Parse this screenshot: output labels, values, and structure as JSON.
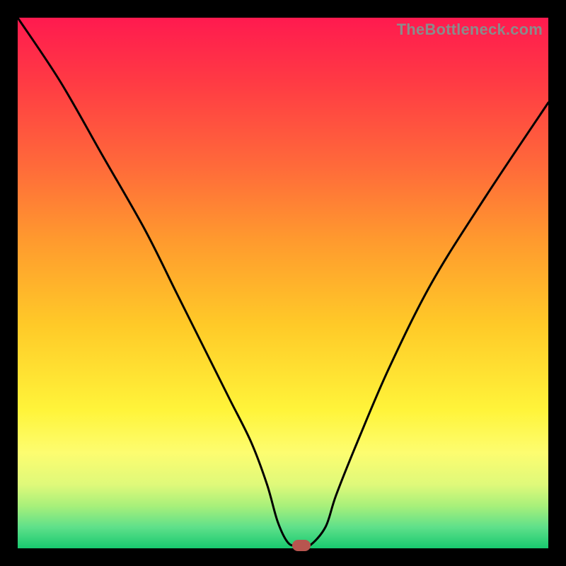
{
  "watermark": "TheBottleneck.com",
  "chart_data": {
    "type": "line",
    "title": "",
    "xlabel": "",
    "ylabel": "",
    "xlim": [
      0,
      100
    ],
    "ylim": [
      0,
      100
    ],
    "grid": false,
    "series": [
      {
        "name": "curve",
        "x": [
          0,
          8,
          16,
          24,
          30,
          36,
          40,
          44,
          47,
          49,
          51,
          53,
          55,
          58,
          60,
          64,
          70,
          78,
          88,
          100
        ],
        "values": [
          100,
          88,
          74,
          60,
          48,
          36,
          28,
          20,
          12,
          5,
          1,
          0.5,
          0.5,
          4,
          10,
          20,
          34,
          50,
          66,
          84
        ]
      }
    ],
    "marker": {
      "x": 53.5,
      "y": 0.5,
      "color": "#b8554f"
    },
    "gradient_stops": [
      {
        "pos": 0,
        "color": "#ff1a4f"
      },
      {
        "pos": 12,
        "color": "#ff3a44"
      },
      {
        "pos": 28,
        "color": "#ff6a3a"
      },
      {
        "pos": 42,
        "color": "#ff9a2e"
      },
      {
        "pos": 58,
        "color": "#ffca28"
      },
      {
        "pos": 74,
        "color": "#fff43a"
      },
      {
        "pos": 82,
        "color": "#fdfd70"
      },
      {
        "pos": 88,
        "color": "#dff97a"
      },
      {
        "pos": 92,
        "color": "#a8f07a"
      },
      {
        "pos": 96,
        "color": "#5fe08a"
      },
      {
        "pos": 100,
        "color": "#18c96f"
      }
    ]
  }
}
